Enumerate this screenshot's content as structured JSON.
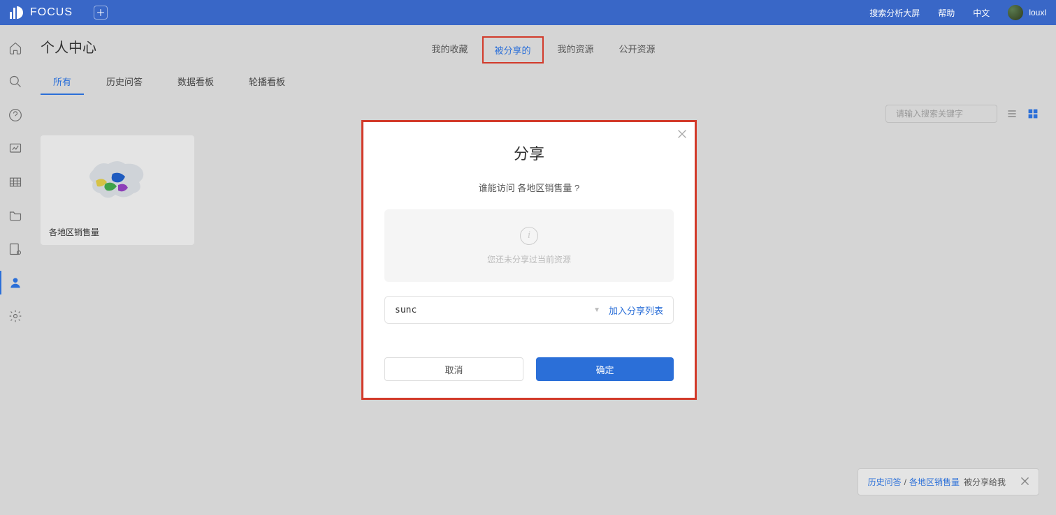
{
  "header": {
    "logo": "FOCUS",
    "links": {
      "bigscreen": "搜索分析大屏",
      "help": "帮助",
      "lang": "中文"
    },
    "user": "louxl"
  },
  "sidebar": {
    "items": [
      "home",
      "search",
      "help",
      "chart",
      "table",
      "folder",
      "config",
      "user",
      "settings"
    ]
  },
  "page": {
    "title": "个人中心"
  },
  "center_tabs": {
    "fav": "我的收藏",
    "shared_to_me": "被分享的",
    "my_res": "我的资源",
    "public": "公开资源"
  },
  "sub_tabs": {
    "all": "所有",
    "history": "历史问答",
    "dashboard": "数据看板",
    "carousel": "轮播看板"
  },
  "search": {
    "placeholder": "请输入搜索关键字"
  },
  "card": {
    "title": "各地区销售量"
  },
  "modal": {
    "title": "分享",
    "question_prefix": "谁能访问 ",
    "question_item": "各地区销售量",
    "question_suffix": " ?",
    "empty_text": "您还未分享过当前资源",
    "input_value": "sunc",
    "add_link": "加入分享列表",
    "cancel": "取消",
    "ok": "确定"
  },
  "toast": {
    "link1": "历史问答",
    "sep": "/",
    "link2": "各地区销售量",
    "suffix": "被分享给我"
  }
}
